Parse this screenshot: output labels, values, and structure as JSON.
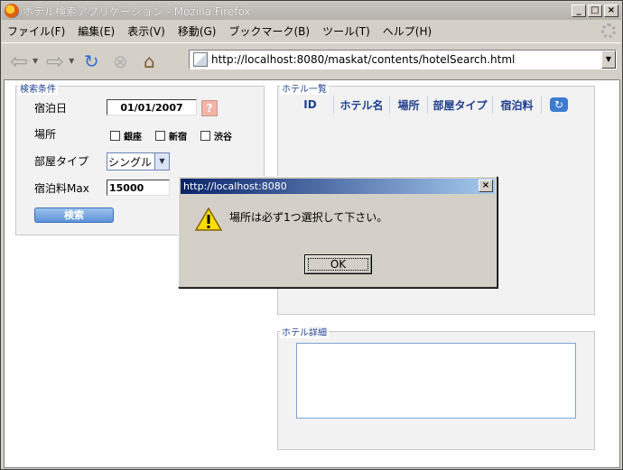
{
  "window": {
    "title": "ホテル検索アプリケーション - Mozilla Firefox"
  },
  "menu": [
    "ファイル(F)",
    "編集(E)",
    "表示(V)",
    "移動(G)",
    "ブックマーク(B)",
    "ツール(T)",
    "ヘルプ(H)"
  ],
  "toolbar": {
    "url": "http://localhost:8080/maskat/contents/hotelSearch.html"
  },
  "search": {
    "title": "検索条件",
    "date_label": "宿泊日",
    "date_value": "01/01/2007",
    "date_help": "?",
    "place_label": "場所",
    "places": [
      "銀座",
      "新宿",
      "渋谷"
    ],
    "room_label": "部屋タイプ",
    "room_value": "シングル",
    "price_label": "宿泊料Max",
    "price_value": "15000",
    "search_button": "検索"
  },
  "hotels": {
    "title": "ホテル一覧",
    "columns": [
      "ID",
      "ホテル名",
      "場所",
      "部屋タイプ",
      "宿泊料"
    ]
  },
  "detail": {
    "title": "ホテル詳細"
  },
  "dialog": {
    "title": "http://localhost:8080",
    "message": "場所は必ず1つ選択して下さい。",
    "ok": "OK"
  }
}
